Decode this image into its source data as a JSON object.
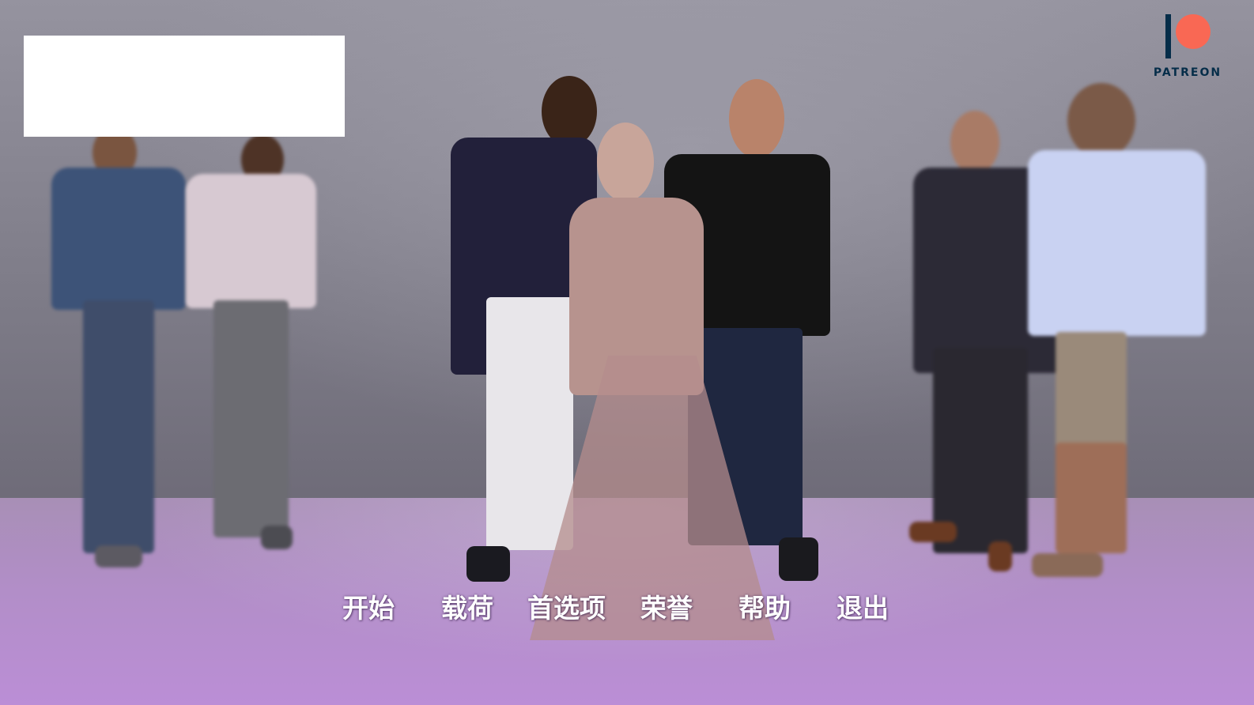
{
  "menu": {
    "start": "开始",
    "load": "载荷",
    "preferences": "首选项",
    "honors": "荣誉",
    "help": "帮助",
    "quit": "退出"
  },
  "patreon": {
    "label": "PATREON",
    "colors": {
      "mark": "#052d49",
      "circle": "#f96854"
    }
  },
  "colors": {
    "floor": "#b28ec8",
    "wall": "#7d7b87",
    "menu_text": "#ffffff"
  }
}
